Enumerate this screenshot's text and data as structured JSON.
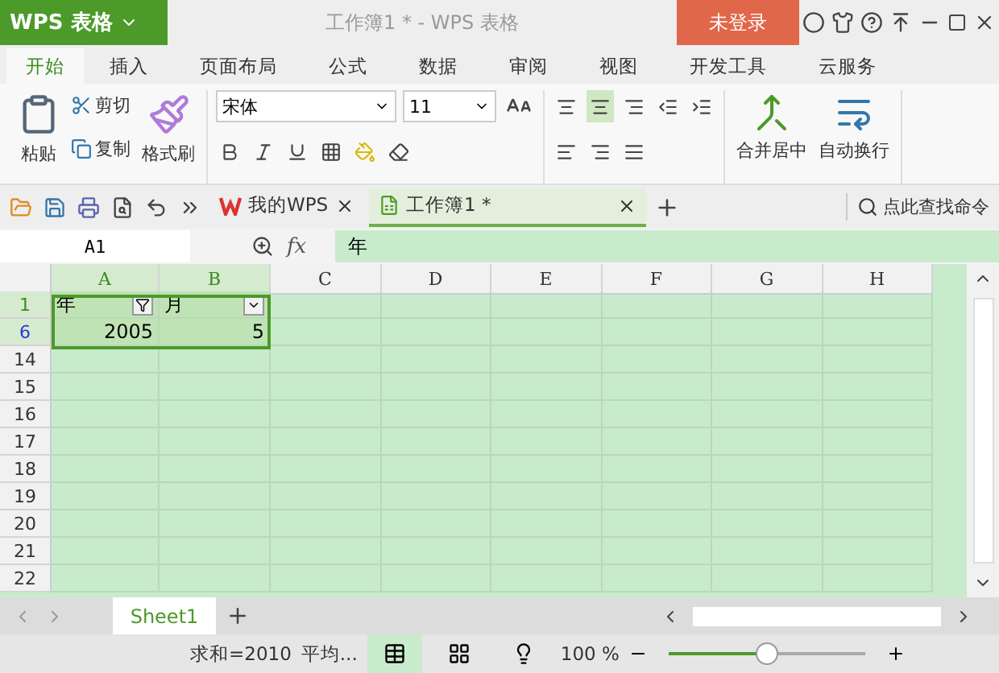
{
  "title_bar": {
    "app_button": "WPS 表格",
    "title": "工作簿1 * - WPS 表格",
    "login": "未登录"
  },
  "menu_tabs": [
    {
      "label": "开始",
      "selected": true
    },
    {
      "label": "插入",
      "selected": false
    },
    {
      "label": "页面布局",
      "selected": false
    },
    {
      "label": "公式",
      "selected": false
    },
    {
      "label": "数据",
      "selected": false
    },
    {
      "label": "审阅",
      "selected": false
    },
    {
      "label": "视图",
      "selected": false
    },
    {
      "label": "开发工具",
      "selected": false
    },
    {
      "label": "云服务",
      "selected": false
    }
  ],
  "ribbon": {
    "paste": "粘贴",
    "cut": "剪切",
    "copy": "复制",
    "format_painter": "格式刷",
    "font_name": "宋体",
    "font_size": "11",
    "align_buttons": [
      {
        "selected": false
      },
      {
        "selected": true
      },
      {
        "selected": false
      }
    ],
    "merge": "合并居中",
    "wrap": "自动换行"
  },
  "doc_tabs": [
    {
      "label": "我的WPS",
      "selected": false
    },
    {
      "label": "工作簿1 *",
      "selected": true
    }
  ],
  "search": {
    "placeholder": "点此查找命令"
  },
  "formula_bar": {
    "cell_ref": "A1",
    "fx": "fx",
    "value": "年"
  },
  "columns": [
    {
      "label": "A",
      "selected": true
    },
    {
      "label": "B",
      "selected": true
    },
    {
      "label": "C",
      "selected": false
    },
    {
      "label": "D",
      "selected": false
    },
    {
      "label": "E",
      "selected": false
    },
    {
      "label": "F",
      "selected": false
    },
    {
      "label": "G",
      "selected": false
    },
    {
      "label": "H",
      "selected": false
    }
  ],
  "rows": [
    {
      "number": "1",
      "selected": true,
      "filtered": false,
      "kind": "header",
      "cells": [
        {
          "text": "年",
          "filter_applied": true
        },
        {
          "text": "月",
          "filter_applied": false
        }
      ]
    },
    {
      "number": "6",
      "selected": true,
      "filtered": true,
      "kind": "data",
      "cells": [
        {
          "text": "2005"
        },
        {
          "text": "5"
        }
      ]
    },
    {
      "number": "14",
      "selected": false,
      "filtered": false,
      "cells": []
    },
    {
      "number": "15",
      "selected": false,
      "filtered": false,
      "cells": []
    },
    {
      "number": "16",
      "selected": false,
      "filtered": false,
      "cells": []
    },
    {
      "number": "17",
      "selected": false,
      "filtered": false,
      "cells": []
    },
    {
      "number": "18",
      "selected": false,
      "filtered": false,
      "cells": []
    },
    {
      "number": "19",
      "selected": false,
      "filtered": false,
      "cells": []
    },
    {
      "number": "20",
      "selected": false,
      "filtered": false,
      "cells": []
    },
    {
      "number": "21",
      "selected": false,
      "filtered": false,
      "cells": []
    },
    {
      "number": "22",
      "selected": false,
      "filtered": false,
      "cells": []
    }
  ],
  "sheet_tabs": [
    {
      "label": "Sheet1",
      "selected": true
    }
  ],
  "status_bar": {
    "sum": "求和=2010",
    "average": "平均...",
    "view_modes": [
      {
        "selected": true
      },
      {
        "selected": false
      },
      {
        "selected": false
      }
    ],
    "zoom": "100 %",
    "zoom_slider": {
      "level": 0.5
    }
  }
}
